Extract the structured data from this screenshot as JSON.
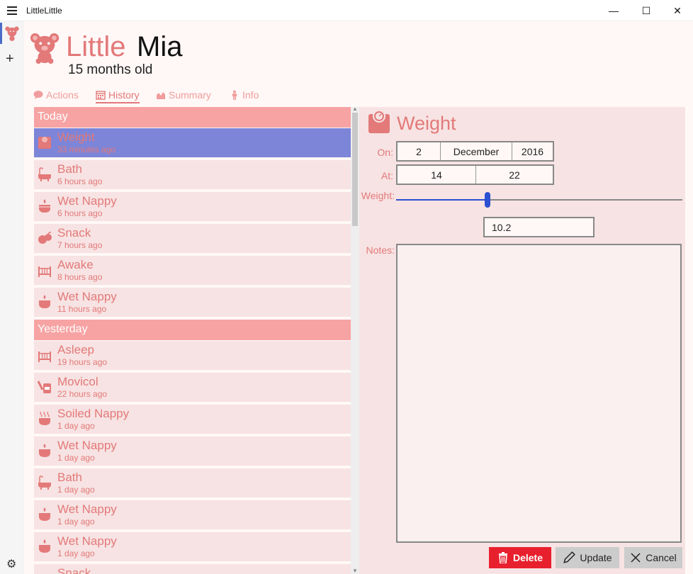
{
  "window": {
    "title": "LittleLittle"
  },
  "header": {
    "name_first": "Little",
    "name_second": "Mia",
    "age": "15 months old"
  },
  "tabs": [
    {
      "label": "Actions",
      "active": false,
      "icon": "chat-icon"
    },
    {
      "label": "History",
      "active": true,
      "icon": "calendar-icon"
    },
    {
      "label": "Summary",
      "active": false,
      "icon": "area-chart-icon"
    },
    {
      "label": "Info",
      "active": false,
      "icon": "person-icon"
    }
  ],
  "groups": [
    {
      "label": "Today",
      "items": [
        {
          "title": "Weight",
          "time": "33 minutes ago",
          "icon": "scale-icon",
          "selected": true
        },
        {
          "title": "Bath",
          "time": "6 hours ago",
          "icon": "bath-icon"
        },
        {
          "title": "Wet Nappy",
          "time": "6 hours ago",
          "icon": "wet-nappy-icon"
        },
        {
          "title": "Snack",
          "time": "7 hours ago",
          "icon": "snack-icon"
        },
        {
          "title": "Awake",
          "time": "8 hours ago",
          "icon": "cot-icon"
        },
        {
          "title": "Wet Nappy",
          "time": "11 hours ago",
          "icon": "wet-nappy-icon"
        }
      ]
    },
    {
      "label": "Yesterday",
      "items": [
        {
          "title": "Asleep",
          "time": "19 hours ago",
          "icon": "cot-icon"
        },
        {
          "title": "Movicol",
          "time": "22 hours ago",
          "icon": "medicine-icon"
        },
        {
          "title": "Soiled Nappy",
          "time": "1 day ago",
          "icon": "soiled-nappy-icon"
        },
        {
          "title": "Wet Nappy",
          "time": "1 day ago",
          "icon": "wet-nappy-icon"
        },
        {
          "title": "Bath",
          "time": "1 day ago",
          "icon": "bath-icon"
        },
        {
          "title": "Wet Nappy",
          "time": "1 day ago",
          "icon": "wet-nappy-icon"
        },
        {
          "title": "Wet Nappy",
          "time": "1 day ago",
          "icon": "wet-nappy-icon"
        },
        {
          "title": "Snack",
          "time": "",
          "icon": "snack-icon"
        }
      ]
    }
  ],
  "detail": {
    "title": "Weight",
    "on_label": "On:",
    "date": {
      "day": "2",
      "month": "December",
      "year": "2016"
    },
    "at_label": "At:",
    "time": {
      "hour": "14",
      "minute": "22"
    },
    "weight_label": "Weight:",
    "weight_value": "10.2",
    "slider_fraction": 0.32,
    "notes_label": "Notes:",
    "notes": "",
    "buttons": {
      "delete": "Delete",
      "update": "Update",
      "cancel": "Cancel"
    }
  },
  "colors": {
    "accent": "#e37979",
    "header_row": "#f7a3a3",
    "item_bg": "#f7e3e3",
    "selected": "#7d85d8",
    "delete": "#e8202e",
    "slider": "#2d4fd1"
  }
}
